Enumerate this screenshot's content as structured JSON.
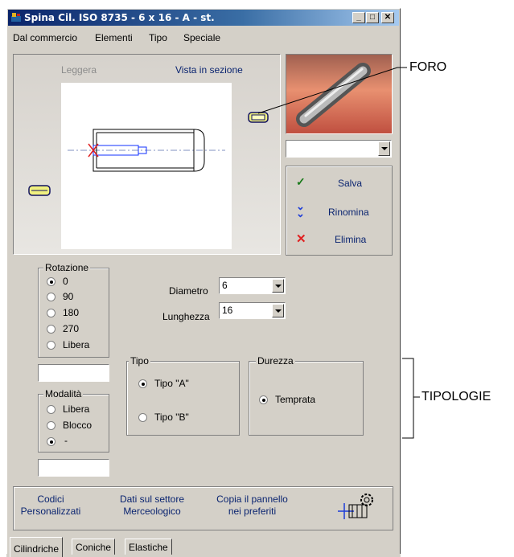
{
  "window": {
    "title": "Spina Cil. ISO 8735 - 6 x 16 - A - st.",
    "minimize": "_",
    "maximize": "□",
    "close": "✕"
  },
  "menu": [
    "Dal commercio",
    "Elementi",
    "Tipo",
    "Speciale"
  ],
  "preview": {
    "light_label": "Leggera",
    "section_label": "Vista in sezione"
  },
  "actions": {
    "save": "Salva",
    "rename": "Rinomina",
    "delete": "Elimina"
  },
  "rotation": {
    "title": "Rotazione",
    "options": [
      "0",
      "90",
      "180",
      "270",
      "Libera"
    ],
    "selected": "0"
  },
  "mode": {
    "title": "Modalità",
    "options": [
      "Libera",
      "Blocco",
      "-"
    ],
    "selected": "-"
  },
  "dimensions": {
    "diameter_label": "Diametro",
    "diameter_value": "6",
    "length_label": "Lunghezza",
    "length_value": "16"
  },
  "tipo": {
    "title": "Tipo",
    "options": [
      "Tipo \"A\"",
      "Tipo \"B\""
    ],
    "selected": "Tipo \"A\""
  },
  "durezza": {
    "title": "Durezza",
    "option": "Temprata"
  },
  "footer": {
    "codes_line1": "Codici",
    "codes_line2": "Personalizzati",
    "data_line1": "Dati sul settore",
    "data_line2": "Merceologico",
    "copy_line1": "Copia il pannello",
    "copy_line2": "nei preferiti"
  },
  "tabs": [
    "Cilindriche",
    "Coniche",
    "Elastiche"
  ],
  "callouts": {
    "hole": "FORO",
    "types": "TIPOLOGIE"
  },
  "colors": {
    "titlebar": "#0a246a",
    "link": "#0a2470",
    "save": "#1a7a1a",
    "rename": "#1c3cd8",
    "delete": "#e02020"
  }
}
